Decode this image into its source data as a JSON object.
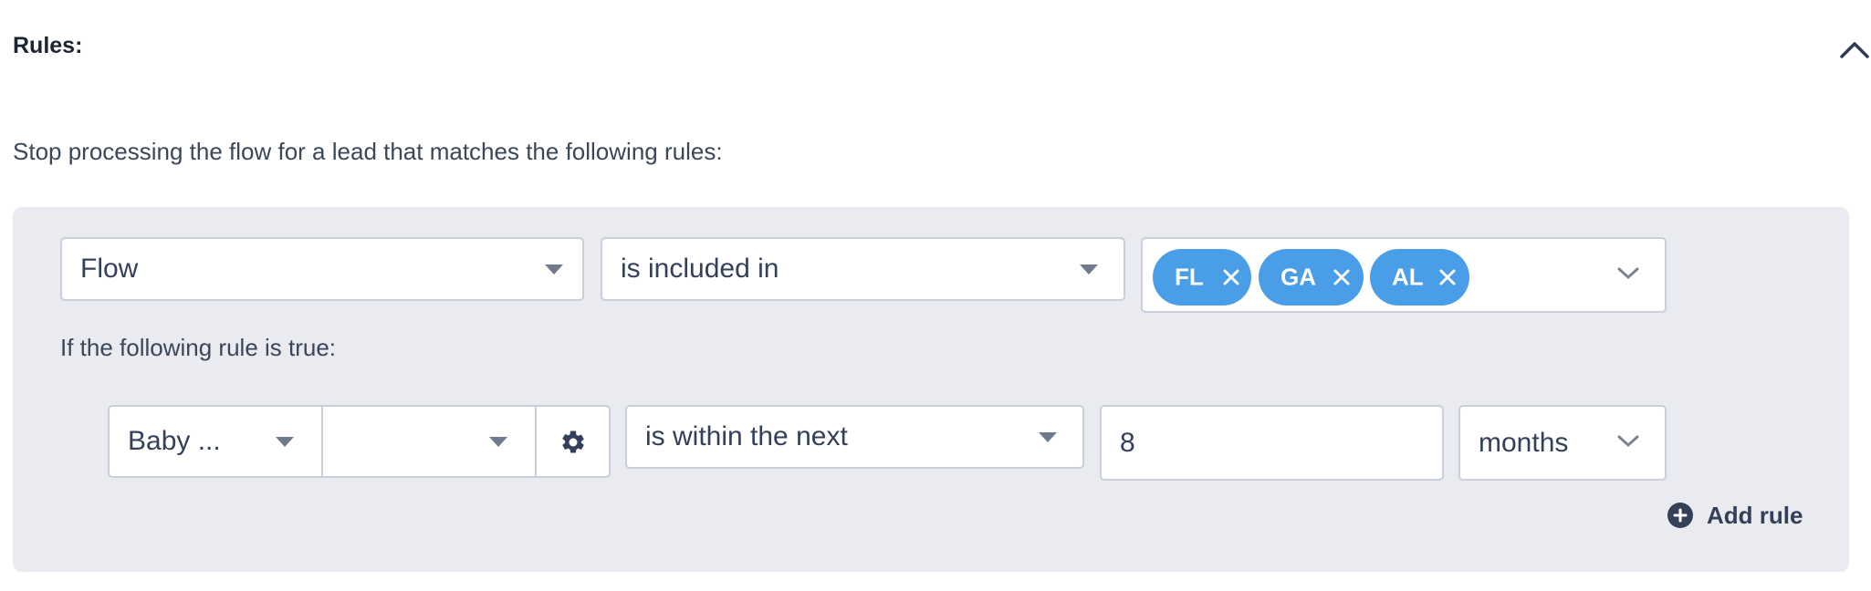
{
  "section": {
    "title": "Rules:",
    "collapse_icon": "chevron-up-icon"
  },
  "description": "Stop processing the flow for a lead that matches the following rules:",
  "main_rule": {
    "field": "Flow",
    "operator": "is included in",
    "values": [
      "FL",
      "GA",
      "AL"
    ]
  },
  "condition_label": "If the following rule is true:",
  "sub_rule": {
    "field": "Baby ...",
    "subfield": "",
    "settings_icon": "gear-icon",
    "operator": "is within the next",
    "amount": "8",
    "unit": "months"
  },
  "add_rule": {
    "label": "Add rule",
    "icon": "plus-circle-icon"
  },
  "colors": {
    "panel_bg": "#e9ebf0",
    "tag_bg": "#4a9ee8",
    "text": "#34405a"
  }
}
